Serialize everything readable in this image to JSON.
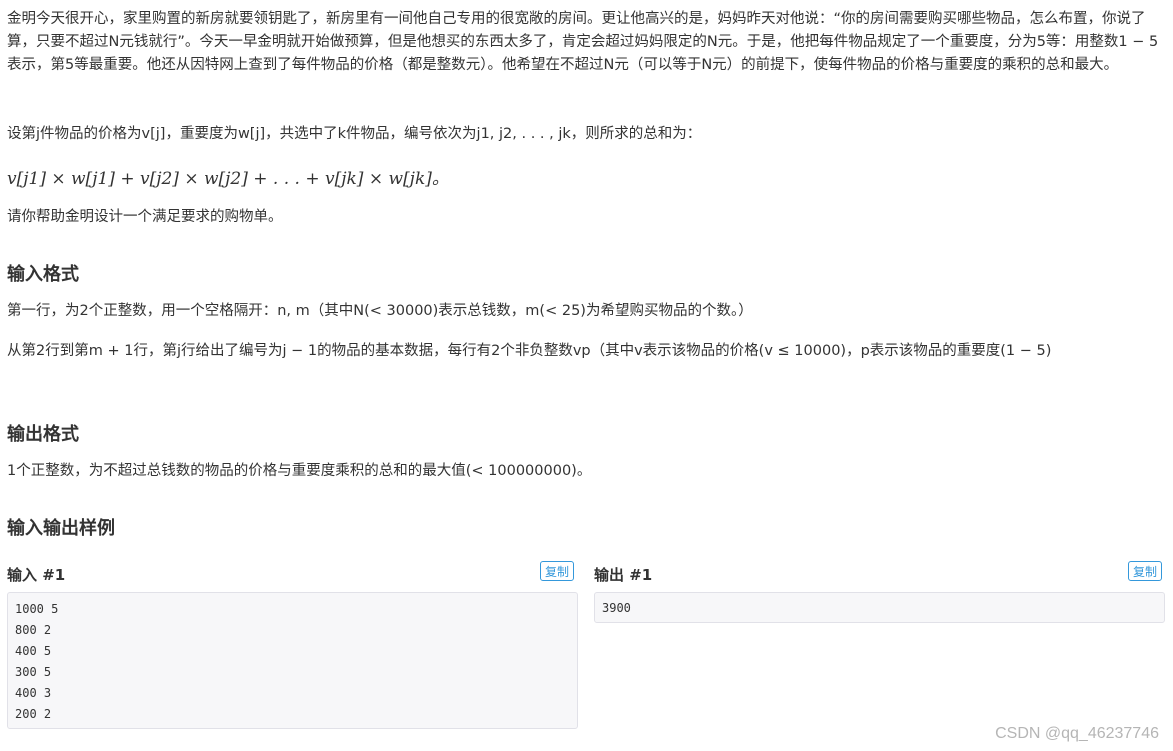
{
  "problem": {
    "paragraph1": "金明今天很开心，家里购置的新房就要领钥匙了，新房里有一间他自己专用的很宽敞的房间。更让他高兴的是，妈妈昨天对他说：“你的房间需要购买哪些物品，怎么布置，你说了算，只要不超过N元钱就行”。今天一早金明就开始做预算，但是他想买的东西太多了，肯定会超过妈妈限定的N元。于是，他把每件物品规定了一个重要度，分为5等：用整数1 − 5表示，第5等最重要。他还从因特网上查到了每件物品的价格（都是整数元）。他希望在不超过N元（可以等于N元）的前提下，使每件物品的价格与重要度的乘积的总和最大。",
    "paragraph2": "设第j件物品的价格为v[j]，重要度为w[j]，共选中了k件物品，编号依次为j1, j2, . . . , jk，则所求的总和为：",
    "formula": "v[j1] × w[j1] + v[j2] × w[j2] + . . . + v[jk] × w[jk]。",
    "paragraph3": "请你帮助金明设计一个满足要求的购物单。"
  },
  "input_format": {
    "heading": "输入格式",
    "line1": "第一行，为2个正整数，用一个空格隔开：n, m（其中N(< 30000)表示总钱数，m(< 25)为希望购买物品的个数。）",
    "line2": "从第2行到第m + 1行，第j行给出了编号为j − 1的物品的基本数据，每行有2个非负整数vp（其中v表示该物品的价格(v ≤ 10000)，p表示该物品的重要度(1 − 5)"
  },
  "output_format": {
    "heading": "输出格式",
    "line1": "1个正整数，为不超过总钱数的物品的价格与重要度乘积的总和的最大值(< 100000000)。"
  },
  "samples": {
    "heading": "输入输出样例",
    "input_label": "输入 #1",
    "output_label": "输出 #1",
    "copy_label": "复制",
    "input_lines": [
      "1000 5",
      "800 2",
      "400 5",
      "300 5",
      "400 3",
      "200 2"
    ],
    "output_lines": [
      "3900"
    ]
  },
  "watermark": "CSDN @qq_46237746"
}
